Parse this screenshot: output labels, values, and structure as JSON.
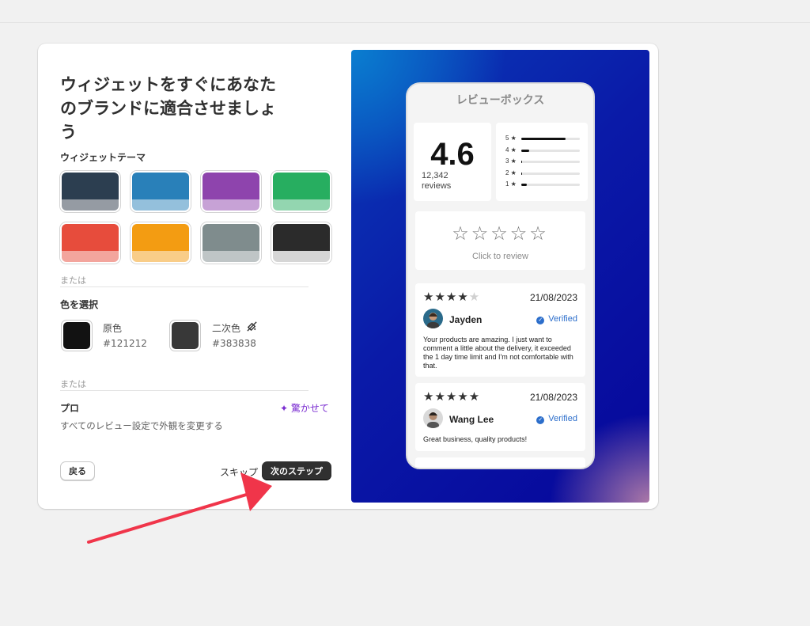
{
  "left": {
    "heading": "ウィジェットをすぐにあなたのブランドに適合させましょう",
    "theme_label": "ウィジェットテーマ",
    "swatches": [
      {
        "top": "#2c3e50",
        "bottom": "#959ba3"
      },
      {
        "top": "#2980b9",
        "bottom": "#94c0dc"
      },
      {
        "top": "#8e44ad",
        "bottom": "#c7a2d6"
      },
      {
        "top": "#27ae60",
        "bottom": "#93d6b0"
      },
      {
        "top": "#e74c3c",
        "bottom": "#f3a59d"
      },
      {
        "top": "#f39c12",
        "bottom": "#f9cd88"
      },
      {
        "top": "#7f8c8d",
        "bottom": "#bfc5c6"
      },
      {
        "top": "#2b2b2b",
        "bottom": "#d6d6d6"
      }
    ],
    "or_1": "または",
    "pick_label": "色を選択",
    "primary": {
      "name": "原色",
      "hex": "#121212"
    },
    "secondary": {
      "name": "二次色",
      "hex": "#383838"
    },
    "or_2": "または",
    "pro_title": "プロ",
    "pro_desc": "すべてのレビュー設定で外観を変更する",
    "surprise": "驚かせて",
    "back": "戻る",
    "skip": "スキップ",
    "next": "次のステップ"
  },
  "preview": {
    "title": "レビューボックス",
    "score": "4.6",
    "count": "12,342",
    "count_unit": "reviews",
    "distribution": [
      {
        "label": "5 ★",
        "fraction": 0.75
      },
      {
        "label": "4 ★",
        "fraction": 0.14
      },
      {
        "label": "3 ★",
        "fraction": 0.02
      },
      {
        "label": "2 ★",
        "fraction": 0.02
      },
      {
        "label": "1 ★",
        "fraction": 0.1
      }
    ],
    "click_to_review": "Click to review",
    "empty_stars": "☆☆☆☆☆",
    "reviews": [
      {
        "stars_on": "★★★★",
        "stars_off": "★",
        "date": "21/08/2023",
        "name": "Jayden",
        "verified": "Verified",
        "text": "Your products are amazing. I just want to comment a little about the delivery, it exceeded the 1 day time limit and I'm not comfortable with that."
      },
      {
        "stars_on": "★★★★★",
        "stars_off": "",
        "date": "21/08/2023",
        "name": "Wang Lee",
        "verified": "Verified",
        "text": "Great business, quality products!"
      }
    ]
  },
  "colors": {
    "accent": "#303030",
    "annotation_arrow": "#f0354a",
    "verified": "#2c6ecb",
    "surprise": "#7b2ed1"
  }
}
